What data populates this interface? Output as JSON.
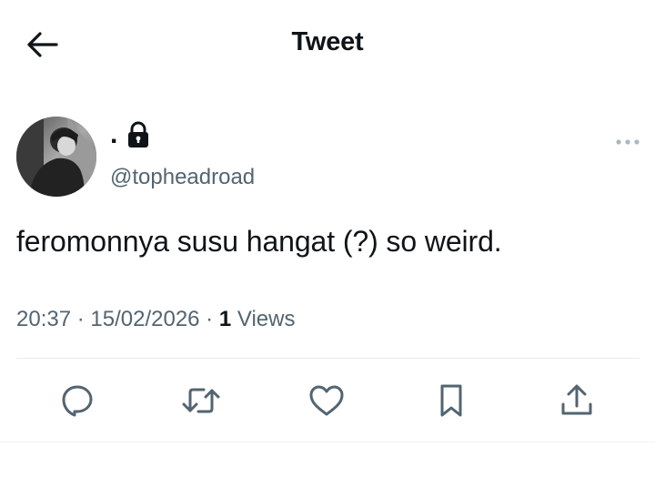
{
  "header": {
    "title": "Tweet",
    "back_icon": "arrow-left-icon"
  },
  "author": {
    "display_name": ".",
    "handle": "@topheadroad",
    "protected_icon": "lock-icon",
    "avatar": "profile-photo"
  },
  "more_icon": "more-horizontal-icon",
  "tweet": {
    "text": "feromonnya susu hangat (?) so weird."
  },
  "meta": {
    "time": "20:37",
    "separator1": " · ",
    "date": "15/02/2026",
    "separator2": " · ",
    "views_count": "1",
    "views_label": " Views"
  },
  "actions": [
    {
      "icon": "reply-icon"
    },
    {
      "icon": "retweet-icon"
    },
    {
      "icon": "like-icon"
    },
    {
      "icon": "bookmark-icon"
    },
    {
      "icon": "share-icon"
    }
  ],
  "colors": {
    "text_primary": "#0f1419",
    "text_secondary": "#536471",
    "divider": "#e7eaec"
  }
}
